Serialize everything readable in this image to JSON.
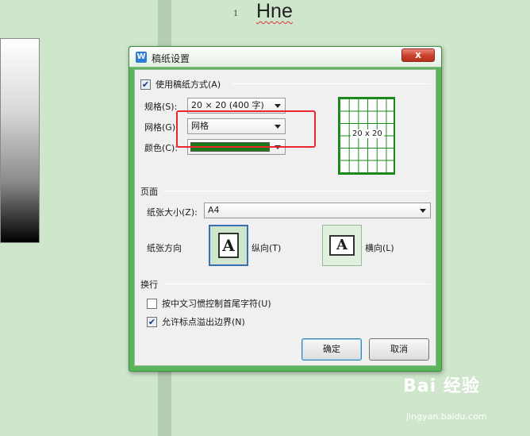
{
  "background": {
    "line_number": "1",
    "doc_text": "Hne"
  },
  "dialog": {
    "title": "稿纸设置",
    "close_label": "x",
    "use_grid_paper": {
      "label": "使用稿纸方式(A)",
      "checked": true
    },
    "spec": {
      "label": "规格(S):",
      "value": "20 × 20 (400 字)"
    },
    "grid": {
      "label": "网格(G):",
      "value": "网格"
    },
    "color": {
      "label": "颜色(C):",
      "value": "#1a7a1a"
    },
    "preview_label": "20 x 20",
    "page_section": {
      "title": "页面",
      "paper_size": {
        "label": "纸张大小(Z):",
        "value": "A4"
      },
      "orientation_label": "纸张方向",
      "portrait": {
        "label": "纵向(T)",
        "icon_letter": "A",
        "selected": true
      },
      "landscape": {
        "label": "横向(L)",
        "icon_letter": "A",
        "selected": false
      }
    },
    "wrap_section": {
      "title": "换行",
      "chinese_control": {
        "label": "按中文习惯控制首尾字符(U)",
        "checked": false
      },
      "punct_overflow": {
        "label": "允许标点溢出边界(N)",
        "checked": true
      }
    },
    "ok_label": "确定",
    "cancel_label": "取消"
  },
  "watermark": {
    "brand": "Bai 经验",
    "site": "jingyan.baidu.com"
  },
  "colors": {
    "dialog_frame": "#5bb55b",
    "highlight": "#e8282a",
    "grid_green": "#1a8a1a"
  }
}
